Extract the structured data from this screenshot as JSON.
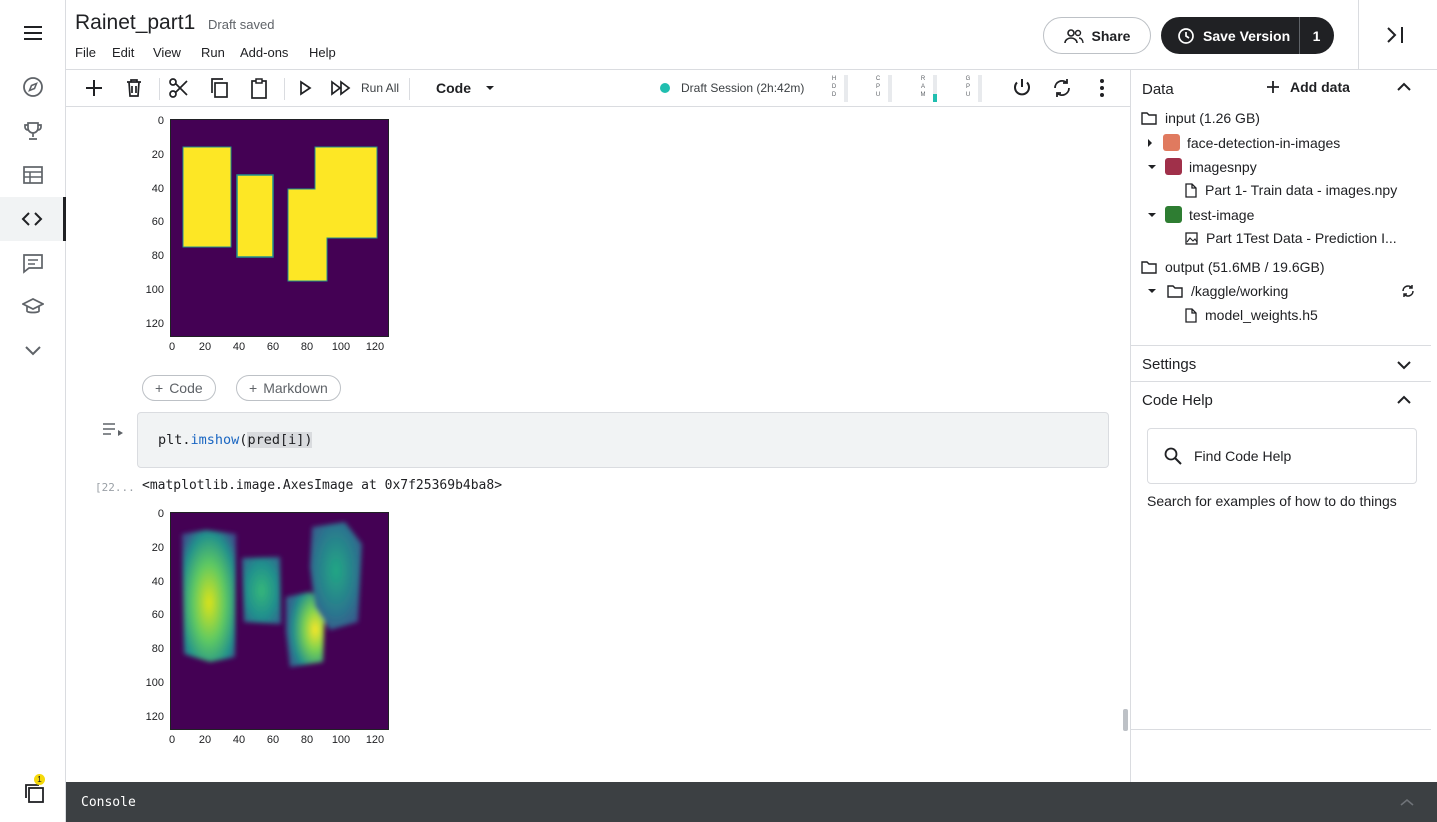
{
  "header": {
    "title": "Rainet_part1",
    "draft_status": "Draft saved",
    "menu": [
      "File",
      "Edit",
      "View",
      "Run",
      "Add-ons",
      "Help"
    ],
    "share_label": "Share",
    "save_version_label": "Save Version",
    "save_version_count": "1"
  },
  "rail": {
    "icons": [
      "menu-icon",
      "compass-icon",
      "trophy-icon",
      "table-icon",
      "code-icon",
      "comment-icon",
      "school-icon",
      "chevron-down-icon"
    ],
    "active": "code-icon",
    "notification_badge": "1"
  },
  "toolbar": {
    "run_all_label": "Run All",
    "cell_type": "Code",
    "session_label": "Draft Session (2h:42m)",
    "session_color": "#20beaf",
    "meters": [
      {
        "label": "HDD",
        "level": 0
      },
      {
        "label": "CPU",
        "level": 0
      },
      {
        "label": "RAM",
        "level": 0.3
      },
      {
        "label": "GPU",
        "level": 0
      }
    ]
  },
  "notebook": {
    "add_code_label": "Code",
    "add_markdown_label": "Markdown",
    "code": {
      "prefix": "plt.",
      "fn": "imshow",
      "open": "(",
      "arg": "pred[i]",
      "close": ")"
    },
    "exec_count": "[22...",
    "output_text": "<matplotlib.image.AxesImage at 0x7f25369b4ba8>",
    "plots": [
      {
        "y_ticks": [
          "0",
          "20",
          "40",
          "60",
          "80",
          "100",
          "120"
        ],
        "x_ticks": [
          "0",
          "20",
          "40",
          "60",
          "80",
          "100",
          "120"
        ],
        "cmap": "viridis"
      },
      {
        "y_ticks": [
          "0",
          "20",
          "40",
          "60",
          "80",
          "100",
          "120"
        ],
        "x_ticks": [
          "0",
          "20",
          "40",
          "60",
          "80",
          "100",
          "120"
        ],
        "cmap": "viridis"
      }
    ]
  },
  "panel": {
    "data_title": "Data",
    "add_data_label": "Add data",
    "input_label": "input (1.26 GB)",
    "datasets": [
      {
        "name": "face-detection-in-images",
        "expanded": false,
        "color": "#e07a5f"
      },
      {
        "name": "imagesnpy",
        "expanded": true,
        "color": "#a0304a",
        "file": "Part 1- Train data - images.npy"
      },
      {
        "name": "test-image",
        "expanded": true,
        "color": "#2e7d32",
        "file": "Part 1Test Data - Prediction I..."
      }
    ],
    "output_label": "output (51.6MB / 19.6GB)",
    "working_dir": "/kaggle/working",
    "output_file": "model_weights.h5",
    "settings_title": "Settings",
    "code_help_title": "Code Help",
    "find_help_label": "Find Code Help",
    "help_desc": "Search for examples of how to do things"
  },
  "console": {
    "label": "Console"
  }
}
